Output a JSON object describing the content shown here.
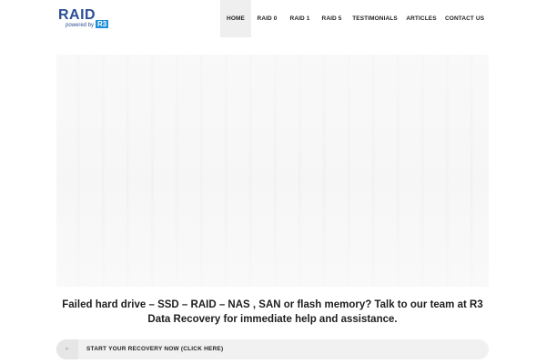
{
  "header": {
    "logo": {
      "name": "RAID",
      "sub": "powered by",
      "badge": "R3"
    },
    "nav": [
      {
        "label": "HOME",
        "active": true
      },
      {
        "label": "RAID 0",
        "active": false
      },
      {
        "label": "RAID 1",
        "active": false
      },
      {
        "label": "RAID 5",
        "active": false
      },
      {
        "label": "TESTIMONIALS",
        "active": false
      },
      {
        "label": "ARTICLES",
        "active": false
      },
      {
        "label": "CONTACT US",
        "active": false
      }
    ]
  },
  "main": {
    "tagline": "Failed hard drive – SSD – RAID – NAS , SAN or flash memory? Talk to our team at R3 Data Recovery for immediate help and assistance.",
    "cta": {
      "icon": "arrow-right-icon",
      "label": "START YOUR RECOVERY NOW (CLICK HERE)"
    }
  },
  "colors": {
    "brand": "#2b4f97",
    "badge": "#1b8fd8",
    "nav_active_bg": "#efefef",
    "cta_bg": "#f1f1f1"
  }
}
